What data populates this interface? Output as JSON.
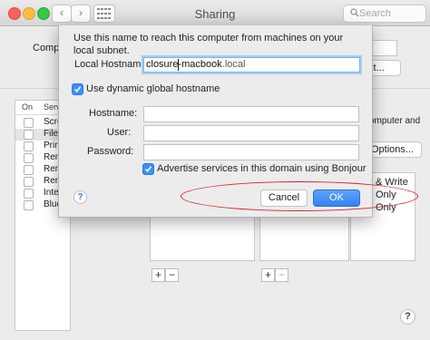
{
  "window": {
    "title": "Sharing"
  },
  "search": {
    "placeholder": "Search"
  },
  "background": {
    "computer_label": "Comput",
    "edit_label": "dit...",
    "service_list": {
      "col_on": "On",
      "col_service": "Serv",
      "items": [
        "Scre",
        "File",
        "Prin",
        "Rem",
        "Rem",
        "Rem",
        "Inter",
        "Blue"
      ]
    },
    "right_text": "computer and",
    "options_label": "Options...",
    "permissions": [
      "& Write",
      "Only",
      "Only"
    ]
  },
  "sheet": {
    "description": "Use this name to reach this computer from machines on your local subnet.",
    "local_hostname_label": "Local Hostname:",
    "local_hostname_value": "closure",
    "local_hostname_value_rest": "macbook",
    "local_hostname_suffix": ".local",
    "dynamic_hostname_label": "Use dynamic global hostname",
    "hostname_label": "Hostname:",
    "user_label": "User:",
    "password_label": "Password:",
    "advertise_label": "Advertise services in this domain using Bonjour",
    "cancel_label": "Cancel",
    "ok_label": "OK",
    "help_glyph": "?"
  },
  "colors": {
    "accent": "#3b8ff8",
    "highlight": "#d6222a"
  },
  "icons": {
    "nav_back": "chevron-left-icon",
    "nav_forward": "chevron-right-icon",
    "grid": "grid-icon",
    "search": "magnifier-icon",
    "help": "help-icon",
    "checkmark": "checkmark-icon"
  }
}
